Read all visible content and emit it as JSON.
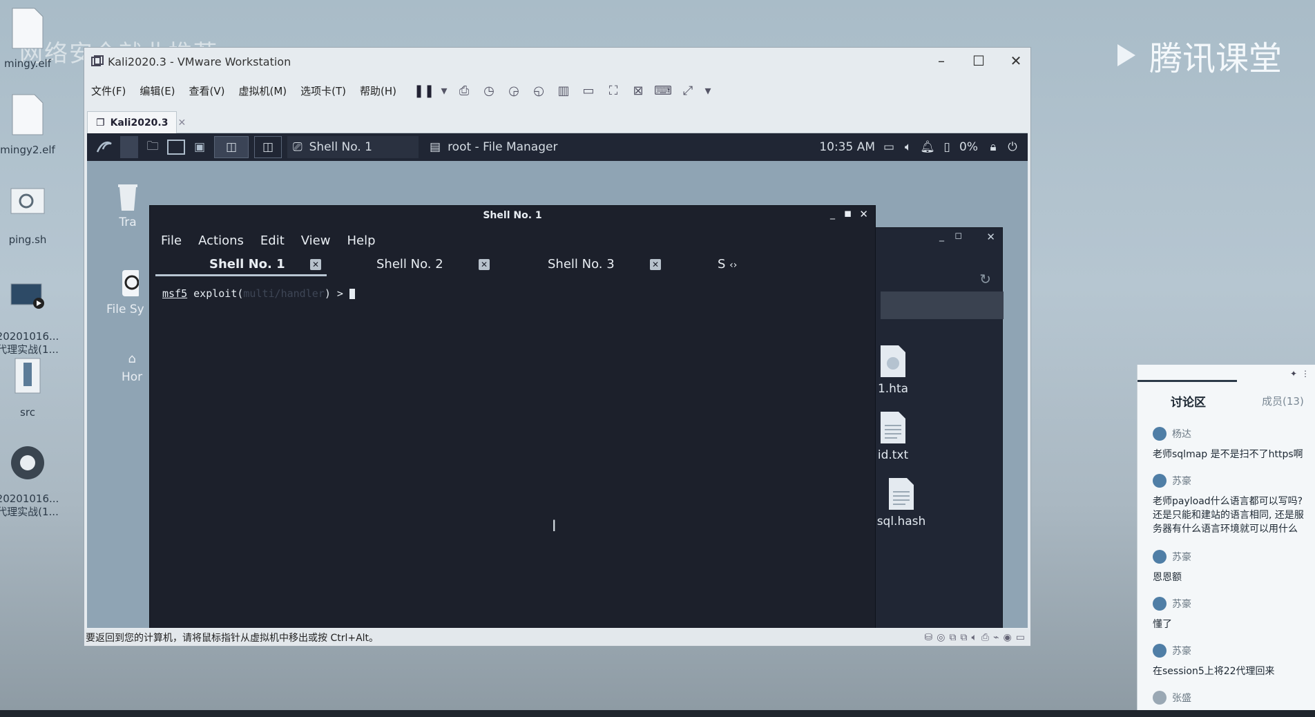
{
  "watermark": "网络安全就业推荐",
  "brand": "腾讯课堂",
  "host_icons": [
    {
      "label": "mingy.elf"
    },
    {
      "label": "mingy2.elf"
    },
    {
      "label": "ping.sh"
    },
    {
      "label": "20201016..."
    },
    {
      "label": "代理实战(1..."
    },
    {
      "label": "src"
    },
    {
      "label": "20201016..."
    },
    {
      "label": "代理实战(1..."
    }
  ],
  "vmware": {
    "title": "Kali2020.3 - VMware Workstation",
    "menu": [
      "文件(F)",
      "编辑(E)",
      "查看(V)",
      "虚拟机(M)",
      "选项卡(T)",
      "帮助(H)"
    ],
    "tab": "Kali2020.3",
    "status": "要返回到您的计算机，请将鼠标指针从虚拟机中移出或按 Ctrl+Alt。"
  },
  "kali": {
    "panel_shell": "Shell No. 1",
    "panel_fm": "root - File Manager",
    "clock": "10:35 AM",
    "battery": "0%",
    "desktop_icons": [
      "Tra",
      "File Sy",
      "Hor"
    ]
  },
  "file_manager": {
    "files": [
      {
        "name": "1.hta",
        "icon": "globe-file-icon"
      },
      {
        "name": "id.txt",
        "icon": "text-file-icon"
      },
      {
        "name": "sql.hash",
        "icon": "text-file-icon"
      }
    ]
  },
  "terminal": {
    "title": "Shell No. 1",
    "menu": [
      "File",
      "Actions",
      "Edit",
      "View",
      "Help"
    ],
    "tabs": [
      "Shell No. 1",
      "Shell No. 2",
      "Shell No. 3",
      "S"
    ],
    "prompt_prefix": "msf5",
    "prompt_cmd": "exploit(",
    "prompt_module": "multi/handler",
    "prompt_end": ") >"
  },
  "chat": {
    "tab_discuss": "讨论区",
    "tab_members": "成员(13)",
    "messages": [
      {
        "name": "杨达",
        "text": "老师sqlmap 是不是扫不了https啊"
      },
      {
        "name": "苏豪",
        "text": "老师payload什么语言都可以写吗? 还是只能和建站的语言相同, 还是服务器有什么语言环境就可以用什么"
      },
      {
        "name": "苏豪",
        "text": "恩恩额"
      },
      {
        "name": "苏豪",
        "text": "懂了"
      },
      {
        "name": "苏豪",
        "text": "在session5上将22代理回来"
      },
      {
        "name": "张盛",
        "text": ""
      }
    ]
  }
}
